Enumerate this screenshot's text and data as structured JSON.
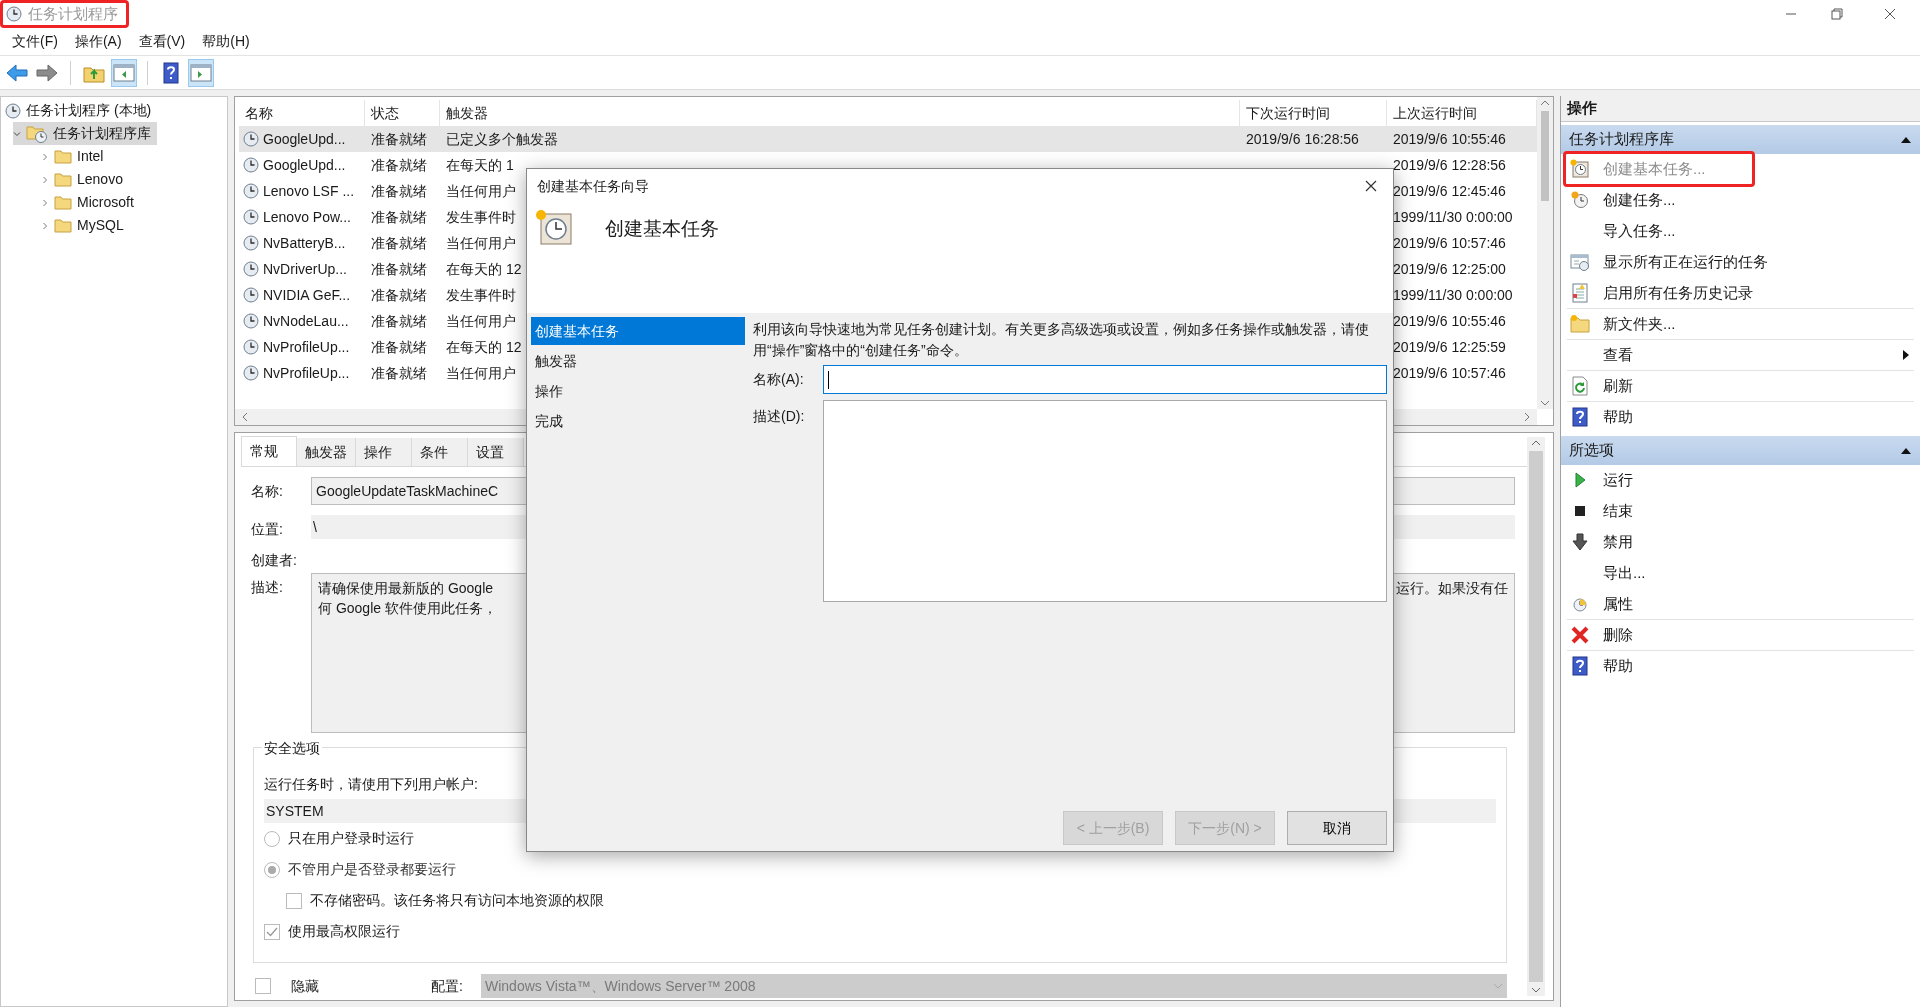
{
  "window": {
    "title": "任务计划程序",
    "highlighted": true
  },
  "menu": [
    "文件(F)",
    "操作(A)",
    "查看(V)",
    "帮助(H)"
  ],
  "toolbar": [
    {
      "on": false
    },
    {
      "on": false
    },
    {
      "on": false
    },
    {
      "on": true
    },
    {
      "on": false
    },
    {
      "on": true
    }
  ],
  "tree": [
    {
      "label": "任务计划程序 (本地)",
      "selected": false,
      "children": [
        {
          "label": "任务计划程序库",
          "selected": true,
          "expanded": true,
          "children": [
            {
              "label": "Intel",
              "selected": false,
              "expanded": false
            },
            {
              "label": "Lenovo",
              "selected": false,
              "expanded": false
            },
            {
              "label": "Microsoft",
              "selected": false,
              "expanded": false
            },
            {
              "label": "MySQL",
              "selected": false,
              "expanded": false
            }
          ]
        }
      ]
    }
  ],
  "table": {
    "columns": [
      "名称",
      "状态",
      "触发器",
      "下次运行时间",
      "上次运行时间"
    ],
    "rows": [
      {
        "name": "GoogleUpd...",
        "status": "准备就绪",
        "trigger": "已定义多个触发器",
        "next_run": "2019/9/6 16:28:56",
        "last_run": "2019/9/6 10:55:46",
        "selected": true
      },
      {
        "name": "GoogleUpd...",
        "status": "准备就绪",
        "trigger": "在每天的 1",
        "last_run": "2019/9/6 12:28:56",
        "selected": false
      },
      {
        "name": "Lenovo LSF ...",
        "status": "准备就绪",
        "trigger": "当任何用户",
        "last_run": "2019/9/6 12:45:46",
        "selected": false
      },
      {
        "name": "Lenovo Pow...",
        "status": "准备就绪",
        "trigger": "发生事件时",
        "last_run": "1999/11/30 0:00:00",
        "selected": false
      },
      {
        "name": "NvBatteryB...",
        "status": "准备就绪",
        "trigger": "当任何用户",
        "last_run": "2019/9/6 10:57:46",
        "selected": false
      },
      {
        "name": "NvDriverUp...",
        "status": "准备就绪",
        "trigger": "在每天的 12",
        "last_run": "2019/9/6 12:25:00",
        "selected": false
      },
      {
        "name": "NVIDIA GeF...",
        "status": "准备就绪",
        "trigger": "发生事件时",
        "last_run": "1999/11/30 0:00:00",
        "selected": false
      },
      {
        "name": "NvNodeLau...",
        "status": "准备就绪",
        "trigger": "当任何用户",
        "last_run": "2019/9/6 10:55:46",
        "selected": false
      },
      {
        "name": "NvProfileUp...",
        "status": "准备就绪",
        "trigger": "在每天的 12",
        "last_run": "2019/9/6 12:25:59",
        "selected": false
      },
      {
        "name": "NvProfileUp...",
        "status": "准备就绪",
        "trigger": "当任何用户",
        "last_run": "2019/9/6 10:57:46",
        "selected": false
      }
    ]
  },
  "properties": {
    "tabs": [
      {
        "label": "常规",
        "selected": true
      },
      {
        "label": "触发器",
        "selected": false
      },
      {
        "label": "操作",
        "selected": false
      },
      {
        "label": "条件",
        "selected": false
      },
      {
        "label": "设置",
        "selected": false
      }
    ],
    "name_label": "名称:",
    "name_value": "GoogleUpdateTaskMachineC",
    "location_label": "位置:",
    "location_value": "\\",
    "author_label": "创建者:",
    "description_label": "描述:",
    "description_left": [
      "请确保使用最新版的 Google",
      "何 Google 软件使用此任务，"
    ],
    "description_right": "运行。如果没有任",
    "security": {
      "title": "安全选项",
      "prompt": "运行任务时，请使用下列用户帐户:",
      "account": "SYSTEM",
      "options": [
        {
          "kind": "radio",
          "label": "只在用户登录时运行",
          "checked": false
        },
        {
          "kind": "radio",
          "label": "不管用户是否登录都要运行",
          "checked": true,
          "children": [
            {
              "kind": "checkbox",
              "label": "不存储密码。该任务将只有访问本地资源的权限",
              "checked": false
            }
          ]
        },
        {
          "kind": "checkbox",
          "label": "使用最高权限运行",
          "checked": true
        }
      ]
    },
    "hidden": {
      "label": "隐藏",
      "checked": false
    },
    "config": {
      "label": "配置:",
      "value": "Windows Vista™、Windows Server™ 2008"
    }
  },
  "actions": {
    "title": "操作",
    "sections": [
      {
        "title": "任务计划程序库",
        "expanded": true,
        "items": [
          {
            "label": "创建基本任务...",
            "disabled": true,
            "highlighted": true
          },
          {
            "label": "创建任务...",
            "disabled": false
          },
          {
            "label": "导入任务...",
            "disabled": false
          },
          {
            "label": "显示所有正在运行的任务",
            "disabled": false
          },
          {
            "label": "启用所有任务历史记录",
            "disabled": false,
            "divider": true
          },
          {
            "label": "新文件夹...",
            "disabled": false,
            "divider": true
          },
          {
            "label": "查看",
            "disabled": false,
            "submenu": true,
            "divider": true
          },
          {
            "label": "刷新",
            "disabled": false,
            "divider": true
          },
          {
            "label": "帮助",
            "disabled": false
          }
        ]
      },
      {
        "title": "所选项",
        "expanded": true,
        "items": [
          {
            "label": "运行",
            "disabled": false
          },
          {
            "label": "结束",
            "disabled": false
          },
          {
            "label": "禁用",
            "disabled": false
          },
          {
            "label": "导出...",
            "disabled": false
          },
          {
            "label": "属性",
            "disabled": false,
            "divider": true
          },
          {
            "label": "删除",
            "disabled": false,
            "divider": true
          },
          {
            "label": "帮助",
            "disabled": false
          }
        ]
      }
    ]
  },
  "dialog": {
    "title": "创建基本任务向导",
    "heading": "创建基本任务",
    "steps": [
      {
        "label": "创建基本任务",
        "selected": true
      },
      {
        "label": "触发器",
        "selected": false
      },
      {
        "label": "操作",
        "selected": false
      },
      {
        "label": "完成",
        "selected": false
      }
    ],
    "intro": "利用该向导快速地为常见任务创建计划。有关更多高级选项或设置，例如多任务操作或触发器，请使用“操作”窗格中的“创建任务”命令。",
    "name_label": "名称(A):",
    "description_label": "描述(D):",
    "buttons": [
      {
        "label": "< 上一步(B)",
        "disabled": true
      },
      {
        "label": "下一步(N) >",
        "disabled": true
      },
      {
        "label": "取消",
        "disabled": false
      }
    ]
  }
}
